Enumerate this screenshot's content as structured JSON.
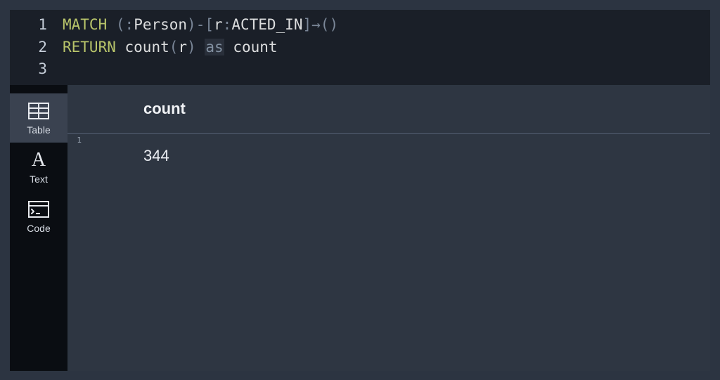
{
  "editor": {
    "lines": [
      {
        "num": "1",
        "tokens": [
          {
            "t": "kw",
            "v": "MATCH"
          },
          {
            "t": "sp",
            "v": " "
          },
          {
            "t": "punc",
            "v": "("
          },
          {
            "t": "punc",
            "v": ":"
          },
          {
            "t": "ident",
            "v": "Person"
          },
          {
            "t": "punc",
            "v": ")"
          },
          {
            "t": "op",
            "v": "-"
          },
          {
            "t": "punc",
            "v": "["
          },
          {
            "t": "ident",
            "v": "r"
          },
          {
            "t": "punc",
            "v": ":"
          },
          {
            "t": "ident",
            "v": "ACTED_IN"
          },
          {
            "t": "punc",
            "v": "]"
          },
          {
            "t": "arrow",
            "v": "→"
          },
          {
            "t": "punc",
            "v": "("
          },
          {
            "t": "punc",
            "v": ")"
          }
        ]
      },
      {
        "num": "2",
        "tokens": [
          {
            "t": "kw",
            "v": "RETURN"
          },
          {
            "t": "sp",
            "v": " "
          },
          {
            "t": "ident",
            "v": "count"
          },
          {
            "t": "punc",
            "v": "("
          },
          {
            "t": "ident",
            "v": "r"
          },
          {
            "t": "punc",
            "v": ")"
          },
          {
            "t": "sp",
            "v": " "
          },
          {
            "t": "as-kw",
            "v": "as"
          },
          {
            "t": "sp",
            "v": " "
          },
          {
            "t": "ident",
            "v": "count"
          }
        ]
      },
      {
        "num": "3",
        "tokens": []
      }
    ]
  },
  "views": {
    "table": "Table",
    "text": "Text",
    "code": "Code",
    "active": "table"
  },
  "result": {
    "column": "count",
    "rows": [
      {
        "idx": "1",
        "value": "344"
      }
    ]
  }
}
